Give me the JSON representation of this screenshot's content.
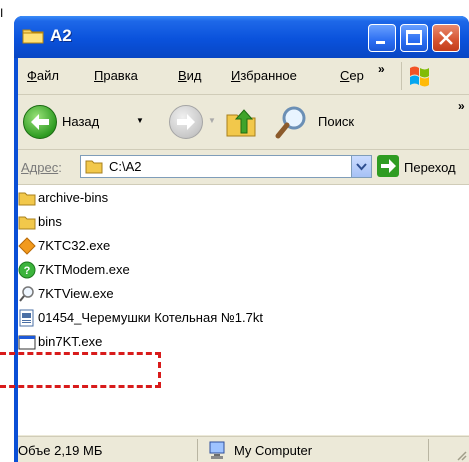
{
  "window": {
    "title": "A2"
  },
  "stray_text": "I",
  "menu": {
    "items": [
      {
        "label": "Файл",
        "key": "Ф",
        "rest": "айл"
      },
      {
        "label": "Правка",
        "key": "П",
        "rest": "равка"
      },
      {
        "label": "Вид",
        "key": "В",
        "rest": "ид"
      },
      {
        "label": "Избранное",
        "key": "И",
        "rest": "збранное"
      },
      {
        "label": "Сер",
        "key": "С",
        "rest": "ер"
      }
    ],
    "overflow": "»"
  },
  "toolbar": {
    "back_label": "Назад",
    "search_label": "Поиск",
    "overflow": "»"
  },
  "address": {
    "label_key": "Адрес",
    "label_colon": ":",
    "path": "C:\\A2",
    "go_label": "Переход"
  },
  "files": [
    {
      "name": "archive-bins",
      "icon": "folder-icon"
    },
    {
      "name": "bins",
      "icon": "folder-icon"
    },
    {
      "name": "7KTC32.exe",
      "icon": "orange-diamond-icon"
    },
    {
      "name": "7KTModem.exe",
      "icon": "green-question-icon"
    },
    {
      "name": "7KTView.exe",
      "icon": "magnifier-icon"
    },
    {
      "name": "01454_Черемушки Котельная №1.7kt",
      "icon": "document-icon"
    },
    {
      "name": "bin7KT.exe",
      "icon": "app-window-icon"
    }
  ],
  "status": {
    "left": "Объе 2,19 МБ",
    "location": "My Computer"
  }
}
